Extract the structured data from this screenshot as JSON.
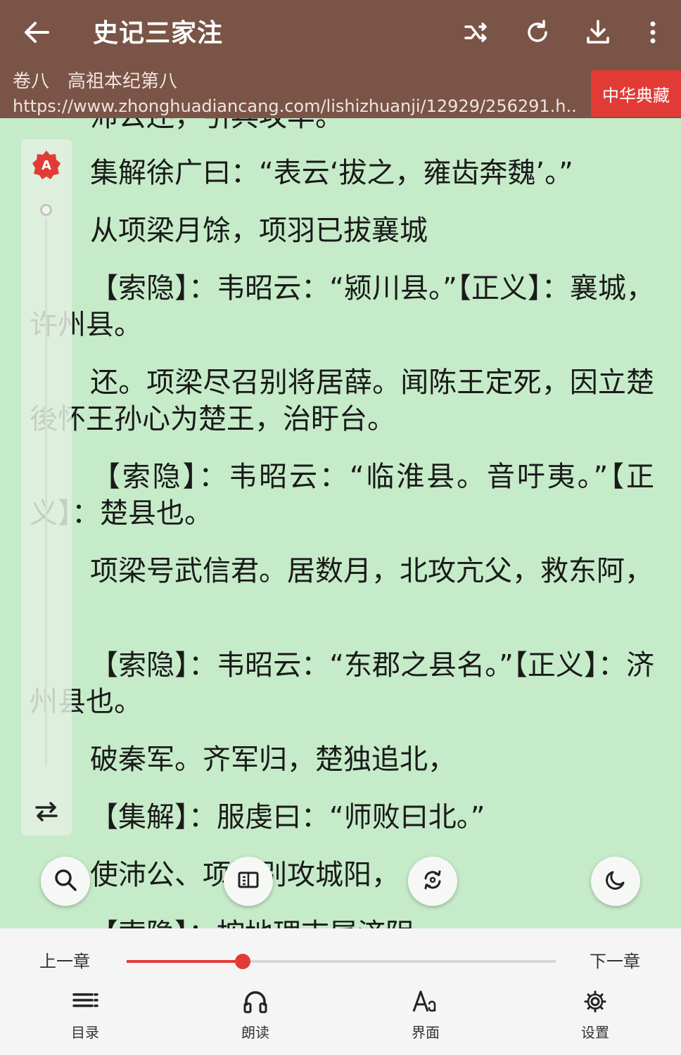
{
  "header": {
    "title": "史记三家注",
    "chapter": "卷八　高祖本纪第八",
    "url": "https://www.zhonghuadiancang.com/lishizhuanji/12929/256291.h...",
    "brand": "中华典藏",
    "bg_color": "#7a5446",
    "brand_color": "#e23b36"
  },
  "content": {
    "partial_top": "沛公还，引兵攻丰。",
    "paragraphs": [
      {
        "text": "集解徐广曰：“表云‘拔之，雍齿奔魏’。”",
        "indent": true
      },
      {
        "text": "从项梁月馀，项羽已拔襄城",
        "indent": true
      },
      {
        "text": "【索隐】：韦昭云：“颍川县。”【正义】：襄城，许州县。",
        "indent": true
      },
      {
        "text": "还。项梁尽召别将居薛。闻陈王定死，因立楚後怀王孙心为楚王，治盱台。",
        "indent": true
      },
      {
        "text": "【索隐】：韦昭云：“临淮县。音吁夷。”【正义】：楚县也。",
        "indent": true
      },
      {
        "text": "项梁号武信君。居数月，北攻亢父，救东阿，",
        "indent": true
      },
      {
        "text": "【索隐】：韦昭云：“东郡之县名。”【正义】：济州县也。",
        "indent": true
      },
      {
        "text": "破秦军。齐军归，楚独追北，",
        "indent": true
      },
      {
        "text": "【集解】：服虔曰：“师败曰北。”",
        "indent": true
      },
      {
        "text": "使沛公、项羽别攻城阳，",
        "indent": false
      }
    ],
    "partial_bottom": "【索隐】：按地理志属济阴",
    "bg_color": "#c6ebc9"
  },
  "footer": {
    "prev_chapter": "上一章",
    "next_chapter": "下一章",
    "progress": 0.27,
    "accent": "#e23b36",
    "tabs": [
      {
        "label": "目录",
        "icon": "list-icon"
      },
      {
        "label": "朗读",
        "icon": "headphones-icon"
      },
      {
        "label": "界面",
        "icon": "font-icon"
      },
      {
        "label": "设置",
        "icon": "gear-icon"
      }
    ]
  },
  "icons": {
    "back": "back-arrow-icon",
    "shuffle": "shuffle-icon",
    "refresh": "refresh-icon",
    "download": "download-icon",
    "more": "more-vert-icon",
    "search": "search-icon",
    "reader_mode": "reader-mode-icon",
    "replace": "replace-icon",
    "night": "night-mode-icon"
  }
}
